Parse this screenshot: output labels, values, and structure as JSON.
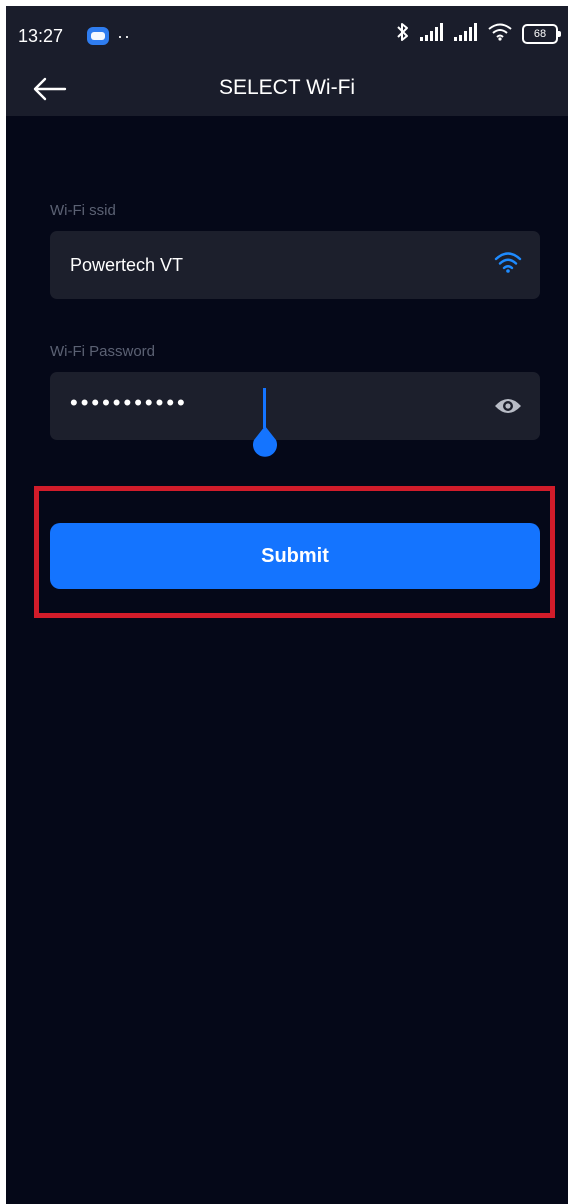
{
  "status_bar": {
    "time": "13:27",
    "notification_dots": "··",
    "battery_level": "68",
    "icons": [
      "zalo-notification-icon",
      "bluetooth-icon",
      "signal-icon",
      "signal-icon",
      "wifi-icon",
      "battery-icon"
    ]
  },
  "header": {
    "title": "SELECT Wi-Fi",
    "back_icon": "arrow-left-icon"
  },
  "form": {
    "ssid_label": "Wi-Fi ssid",
    "ssid_value": "Powertech VT",
    "ssid_icon": "wifi-icon",
    "password_label": "Wi-Fi Password",
    "password_masked": "•••••••••••",
    "password_icon": "eye-icon",
    "submit_label": "Submit"
  },
  "colors": {
    "background": "#050818",
    "bar": "#1a1d2b",
    "field": "#1c1f2c",
    "accent": "#1474ff",
    "highlight": "#d21c2a"
  }
}
